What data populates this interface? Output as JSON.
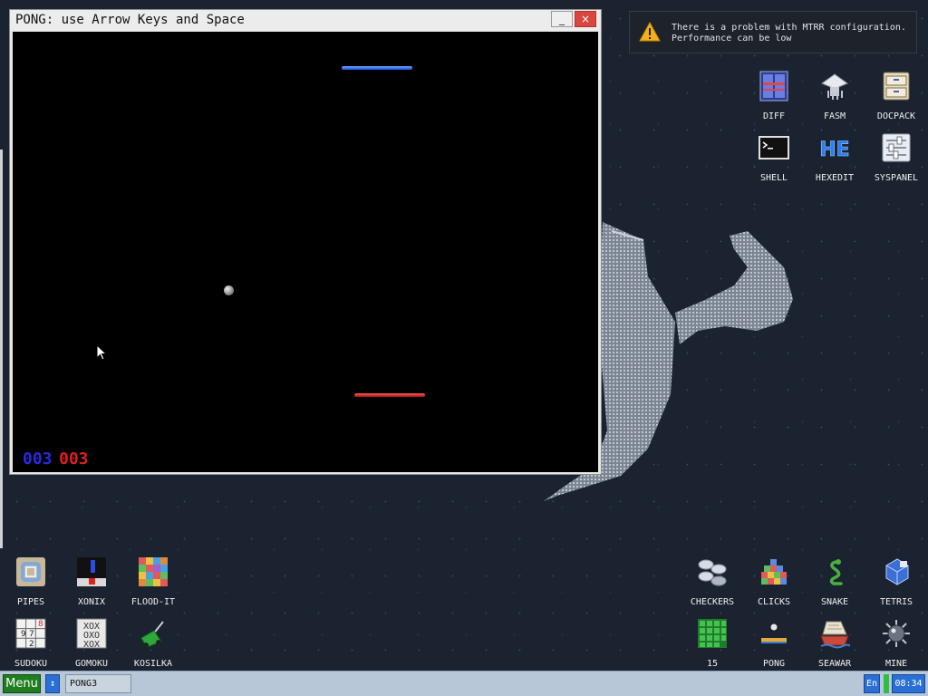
{
  "window": {
    "title": "PONG: use Arrow Keys and Space",
    "minimize_label": "_",
    "close_label": "×",
    "score_blue": "003",
    "score_red": "003"
  },
  "notification": {
    "text": "There is a problem with MTRR configuration.\nPerformance can be low"
  },
  "desktop_icons_top": [
    "DIFF",
    "FASM",
    "DOCPACK",
    "SHELL",
    "HEXEDIT",
    "SYSPANEL"
  ],
  "desktop_icons_left": [
    "PIPES",
    "XONIX",
    "FLOOD-IT",
    "SUDOKU",
    "GOMOKU",
    "KOSILKA"
  ],
  "desktop_icons_right": [
    "CHECKERS",
    "CLICKS",
    "SNAKE",
    "TETRIS",
    "15",
    "PONG",
    "SEAWAR",
    "MINE"
  ],
  "taskbar": {
    "menu_label": "Menu",
    "switch_label": "↕",
    "task_label": "PONG3",
    "lang_label": "En",
    "clock": "08:34"
  },
  "colors": {
    "player_blue": "#2a2ae0",
    "player_red": "#e01e1e",
    "menu_green": "#1f7d1f",
    "taskbar_blue": "#2a6fd6"
  }
}
